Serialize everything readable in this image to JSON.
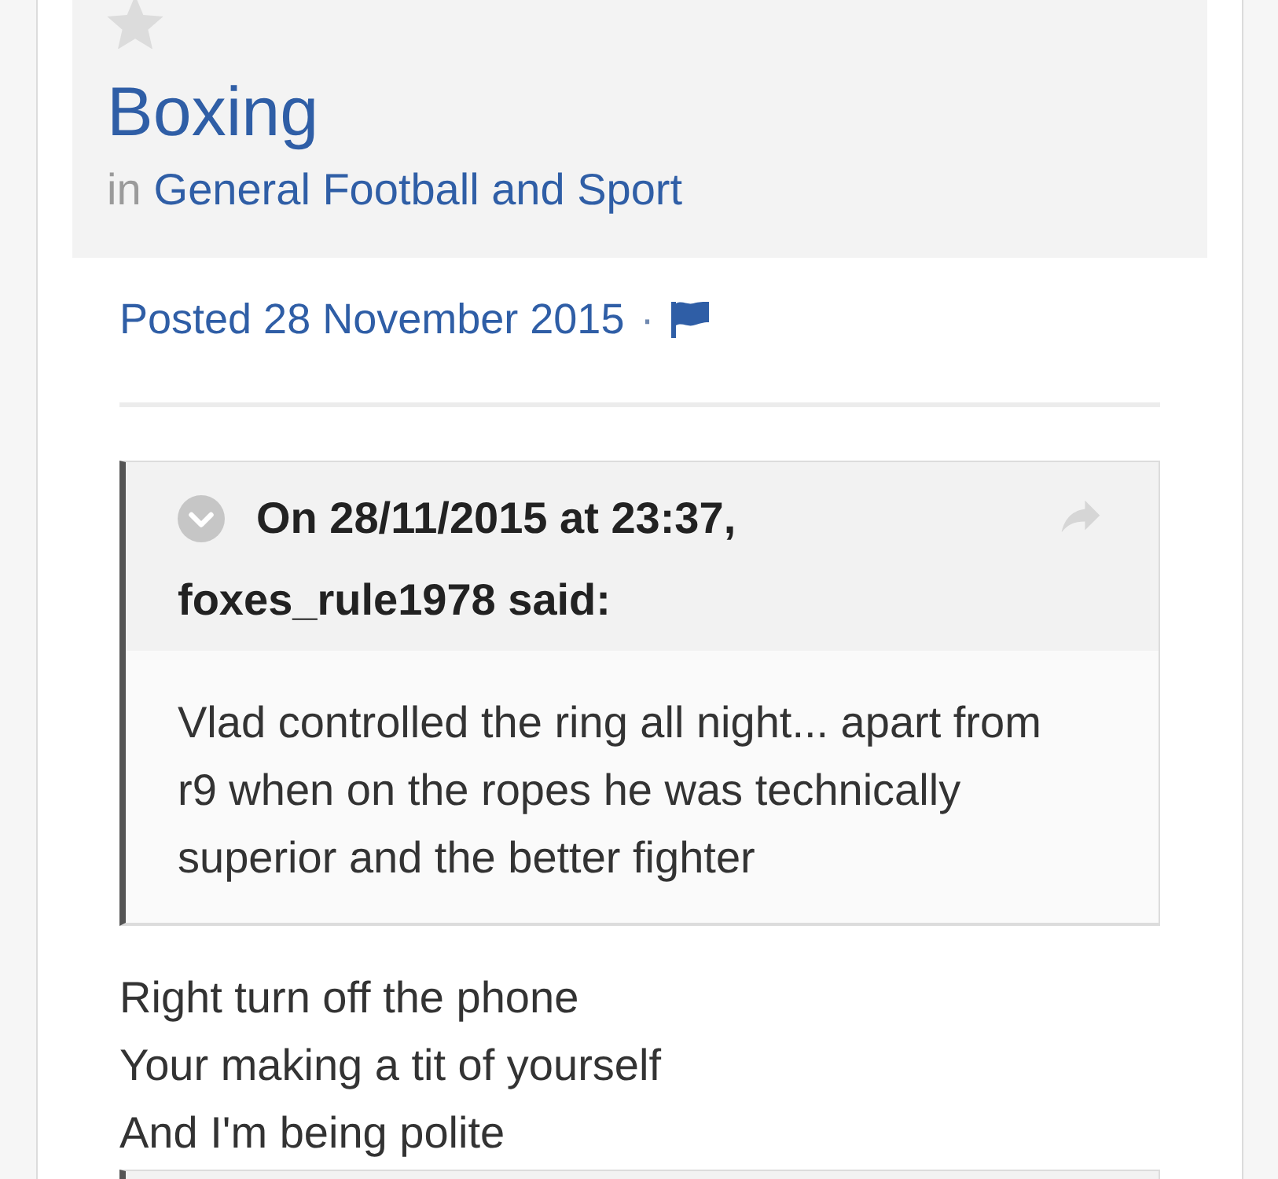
{
  "topic": {
    "title": "Boxing",
    "forum_prefix": "in",
    "forum": "General Football and Sport"
  },
  "post": {
    "posted": "Posted 28 November 2015",
    "separator": "·",
    "blocks": [
      {
        "kind": "quote",
        "header_lines": [
          "On 28/11/2015 at 23:37,",
          "foxes_rule1978 said:"
        ],
        "body": "Vlad controlled the ring all night... apart from r9 when on the ropes he was technically superior and the better fighter"
      },
      {
        "kind": "text",
        "text": "Right turn off the phone"
      },
      {
        "kind": "text",
        "text": "Your making a tit of yourself"
      },
      {
        "kind": "text",
        "text": "And I'm being polite"
      },
      {
        "kind": "quote"
      }
    ]
  }
}
